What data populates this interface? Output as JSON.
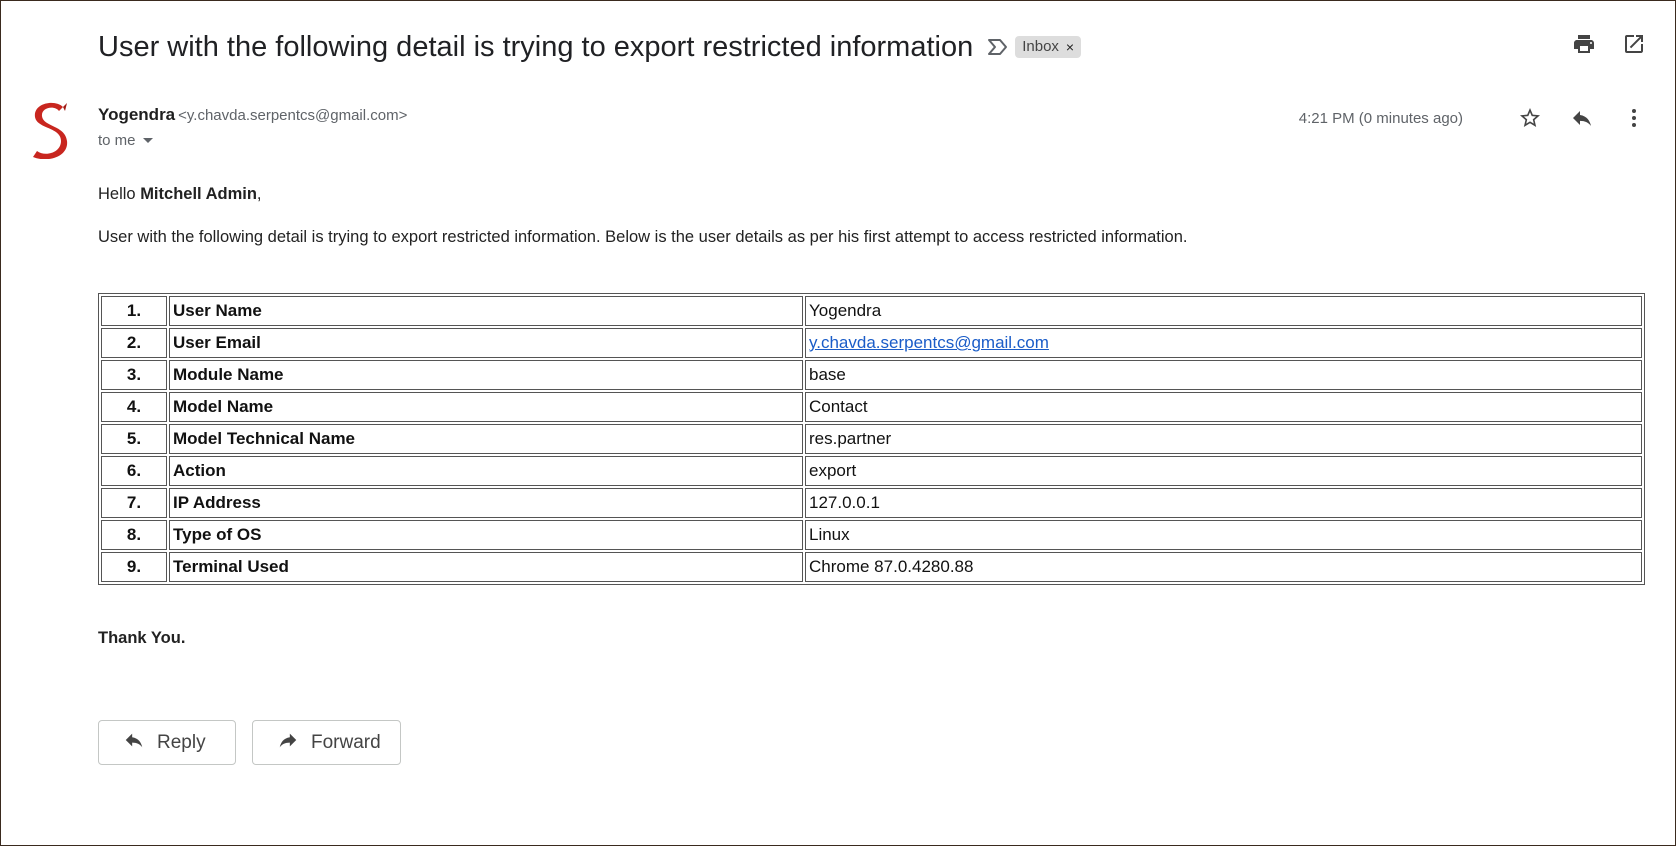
{
  "email": {
    "subject": "User with the following detail is trying to export restricted information",
    "label": "Inbox",
    "label_remove": "×",
    "sender": {
      "name": "Yogendra",
      "email": "<y.chavda.serpentcs@gmail.com>"
    },
    "recipient": "to me",
    "timestamp": "4:21 PM (0 minutes ago)",
    "body": {
      "greeting_prefix": "Hello ",
      "greeting_name": "Mitchell Admin",
      "greeting_suffix": ",",
      "intro": "User with the following detail is trying to export restricted information. Below is the user details as per his first attempt to access restricted information.",
      "closing": "Thank You."
    },
    "details": [
      {
        "num": "1.",
        "field": "User Name",
        "value": "Yogendra"
      },
      {
        "num": "2.",
        "field": "User Email",
        "value": "y.chavda.serpentcs@gmail.com"
      },
      {
        "num": "3.",
        "field": "Module Name",
        "value": "base"
      },
      {
        "num": "4.",
        "field": "Model Name",
        "value": "Contact"
      },
      {
        "num": "5.",
        "field": "Model Technical Name",
        "value": "res.partner"
      },
      {
        "num": "6.",
        "field": "Action",
        "value": "export"
      },
      {
        "num": "7.",
        "field": "IP Address",
        "value": "127.0.0.1"
      },
      {
        "num": "8.",
        "field": "Type of OS",
        "value": "Linux"
      },
      {
        "num": "9.",
        "field": "Terminal Used",
        "value": "Chrome 87.0.4280.88"
      }
    ]
  },
  "actions": {
    "reply_label": "Reply",
    "forward_label": "Forward"
  },
  "icons": {
    "important": "importance-marker-icon",
    "print": "print-icon",
    "open_new_window": "open-in-new-window-icon",
    "star": "star-icon",
    "reply": "reply-icon",
    "more": "more-vert-icon",
    "dropdown": "chevron-down-icon",
    "forward": "forward-icon"
  },
  "colors": {
    "avatar_red": "#c8261f",
    "link_blue": "#1a5cc8",
    "chip_bg": "#dddddd"
  }
}
